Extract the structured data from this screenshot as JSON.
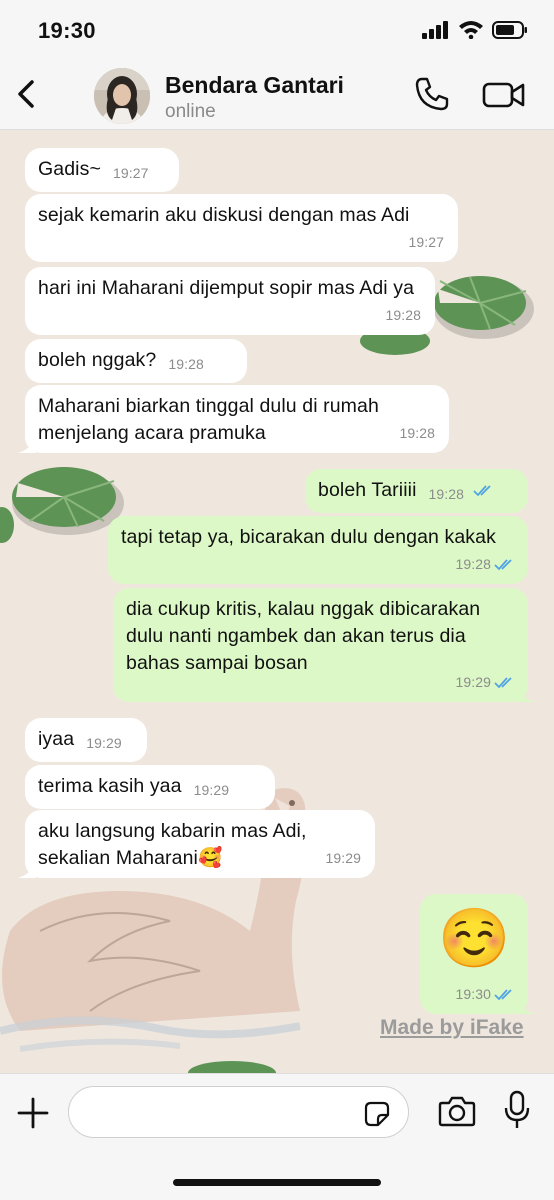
{
  "status_bar": {
    "time": "19:30"
  },
  "contact": {
    "name": "Bendara Gantari",
    "presence": "online"
  },
  "messages": [
    {
      "dir": "in",
      "text": "Gadis~",
      "time": "19:27"
    },
    {
      "dir": "in",
      "text": "sejak kemarin aku diskusi dengan mas Adi",
      "time": "19:27"
    },
    {
      "dir": "in",
      "text": "hari ini Maharani dijemput sopir mas Adi ya",
      "time": "19:28"
    },
    {
      "dir": "in",
      "text": "boleh nggak?",
      "time": "19:28"
    },
    {
      "dir": "in",
      "text": "Maharani biarkan tinggal dulu di rumah menjelang acara pramuka",
      "time": "19:28"
    },
    {
      "dir": "out",
      "text": "boleh Tariiii",
      "time": "19:28"
    },
    {
      "dir": "out",
      "text": "tapi tetap ya, bicarakan dulu dengan kakak",
      "time": "19:28"
    },
    {
      "dir": "out",
      "text": "dia cukup kritis, kalau nggak dibicarakan dulu nanti ngambek dan akan terus dia bahas sampai bosan",
      "time": "19:29"
    },
    {
      "dir": "in",
      "text": "iyaa",
      "time": "19:29"
    },
    {
      "dir": "in",
      "text": "terima kasih yaa",
      "time": "19:29"
    },
    {
      "dir": "in",
      "text": "aku langsung kabarin mas Adi, sekalian Maharani🥰",
      "time": "19:29"
    },
    {
      "dir": "out",
      "text": "☺️",
      "time": "19:30"
    }
  ],
  "watermark": "Made by iFake",
  "colors": {
    "incoming": "#ffffff",
    "outgoing": "#dcf8c6",
    "read_ticks": "#4fa3e6",
    "background": "#efe7de"
  }
}
